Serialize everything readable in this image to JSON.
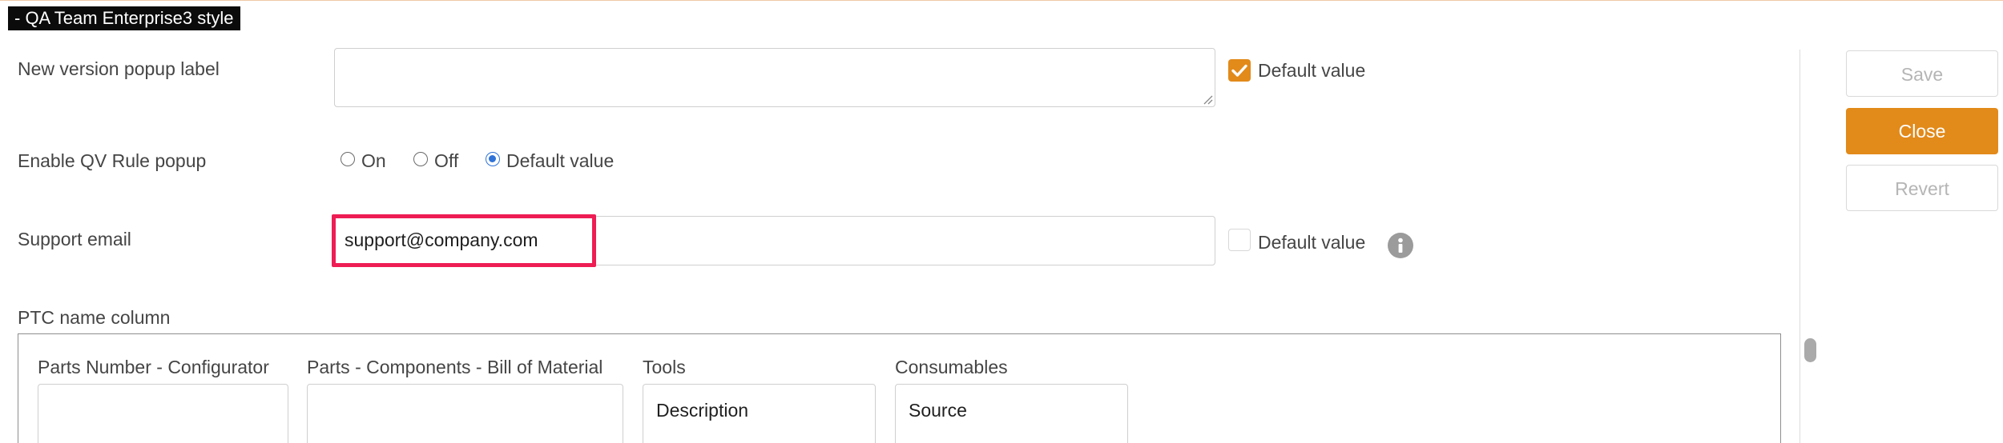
{
  "title_tag": "- QA Team Enterprise3 style",
  "fields": {
    "new_version_popup": {
      "label": "New version popup label",
      "value": "",
      "default_checked": true,
      "default_label": "Default value"
    },
    "qv_rule_popup": {
      "label": "Enable QV Rule popup",
      "options": [
        "On",
        "Off",
        "Default value"
      ],
      "selected": "Default value"
    },
    "support_email": {
      "label": "Support email",
      "value": "support@company.com",
      "default_checked": false,
      "default_label": "Default value"
    }
  },
  "ptc_name_column": {
    "label": "PTC name column",
    "columns": [
      {
        "header": "Parts Number - Configurator",
        "value": ""
      },
      {
        "header": "Parts - Components - Bill of Material",
        "value": ""
      },
      {
        "header": "Tools",
        "value": "Description"
      },
      {
        "header": "Consumables",
        "value": "Source"
      }
    ]
  },
  "actions": {
    "save": "Save",
    "close": "Close",
    "revert": "Revert"
  },
  "colors": {
    "accent": "#e28a1a",
    "highlight": "#ee1d54",
    "radio_selected": "#2f73d8"
  },
  "icons": {
    "info": "info-icon",
    "checkmark": "checkmark-icon"
  }
}
